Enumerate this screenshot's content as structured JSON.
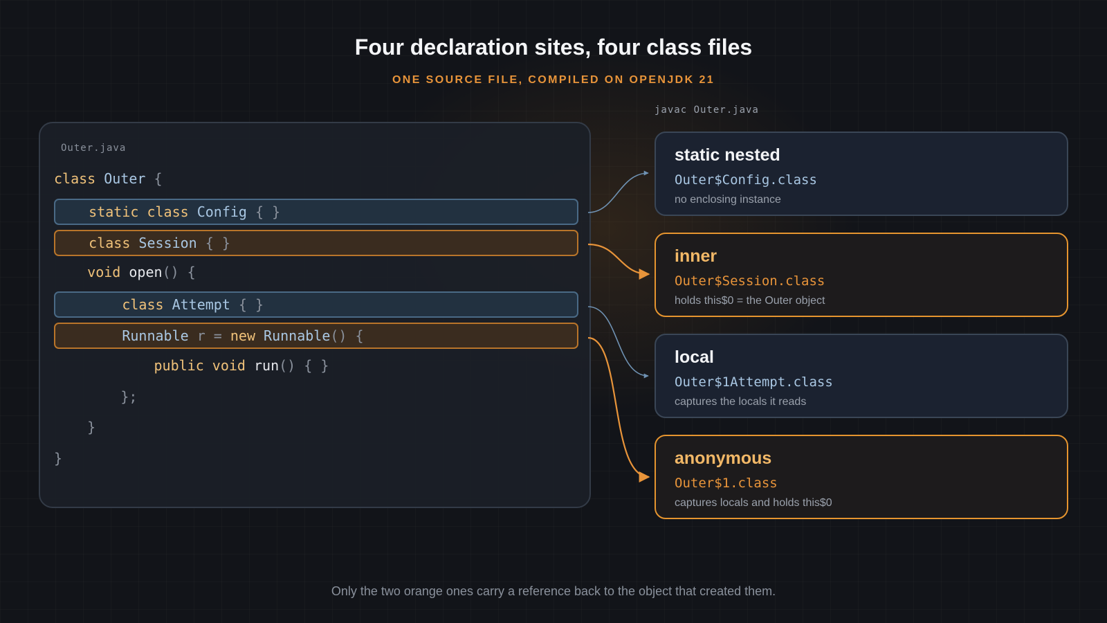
{
  "title": "Four declaration sites, four class files",
  "subtitle": "ONE SOURCE FILE, COMPILED ON OPENJDK 21",
  "code_panel": {
    "filename": "Outer.java",
    "lines": {
      "l1": {
        "kw": "class",
        "name": " Outer",
        "rest": " {"
      },
      "l2": {
        "indent": "    ",
        "kw": "static class",
        "name": " Config",
        "rest": " { }"
      },
      "l3": {
        "indent": "    ",
        "kw": "class",
        "name": " Session",
        "rest": " { }"
      },
      "l4": {
        "indent": "    ",
        "kw": "void",
        "name": " open",
        "rest": "() {"
      },
      "l5": {
        "indent": "        ",
        "kw": "class",
        "name": " Attempt",
        "rest": " { }"
      },
      "l6": {
        "indent": "        ",
        "type": "Runnable",
        "var": " r = ",
        "kw": "new",
        "name": " Runnable",
        "rest": "() {"
      },
      "l7": {
        "indent": "            ",
        "kw": "public void",
        "name": " run",
        "rest": "() { }"
      },
      "l8": {
        "text": "        };"
      },
      "l9": {
        "text": "    }"
      },
      "l10": {
        "text": "}"
      }
    }
  },
  "results": {
    "label": "javac Outer.java",
    "cards": [
      {
        "title": "static nested",
        "file": "Outer$Config.class",
        "desc": "no enclosing instance",
        "highlight": "blue"
      },
      {
        "title": "inner",
        "file": "Outer$Session.class",
        "desc": "holds this$0 = the Outer object",
        "highlight": "orange"
      },
      {
        "title": "local",
        "file": "Outer$1Attempt.class",
        "desc": "captures the locals it reads",
        "highlight": "blue"
      },
      {
        "title": "anonymous",
        "file": "Outer$1.class",
        "desc": "captures locals and holds this$0",
        "highlight": "orange"
      }
    ]
  },
  "colors": {
    "accent_orange": "#e8943a",
    "accent_blue": "#6f92b3",
    "background": "#121419"
  },
  "footer": "Only the two orange ones carry a reference back to the object that created them."
}
